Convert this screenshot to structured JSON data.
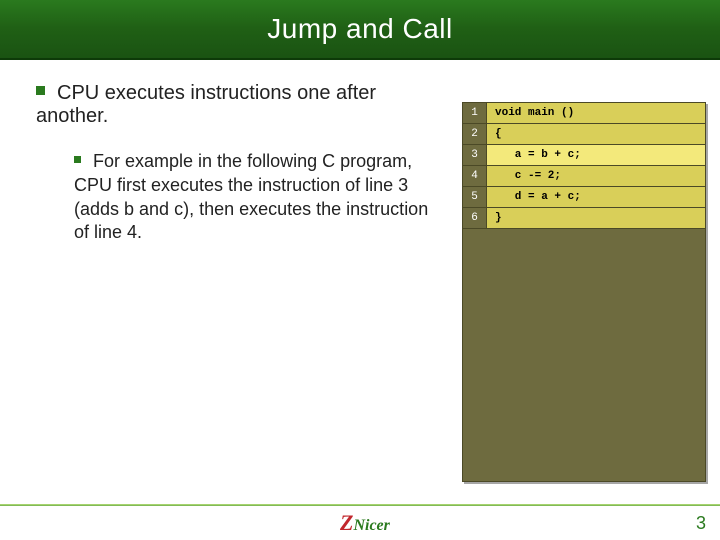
{
  "title": "Jump and Call",
  "bullet1": "CPU executes instructions one after another.",
  "bullet2": "For example in the following C program, CPU first executes the instruction of line 3 (adds b and c), then  executes the instruction of line 4.",
  "code": {
    "lines": [
      {
        "n": "1",
        "text": "void main ()",
        "hl": false
      },
      {
        "n": "2",
        "text": "{",
        "hl": false
      },
      {
        "n": "3",
        "text": "   a = b + c;",
        "hl": true
      },
      {
        "n": "4",
        "text": "   c -= 2;",
        "hl": false
      },
      {
        "n": "5",
        "text": "   d = a + c;",
        "hl": false
      },
      {
        "n": "6",
        "text": "}",
        "hl": false
      }
    ]
  },
  "logo": {
    "z": "Z",
    "rest": "Nicer"
  },
  "page": "3"
}
